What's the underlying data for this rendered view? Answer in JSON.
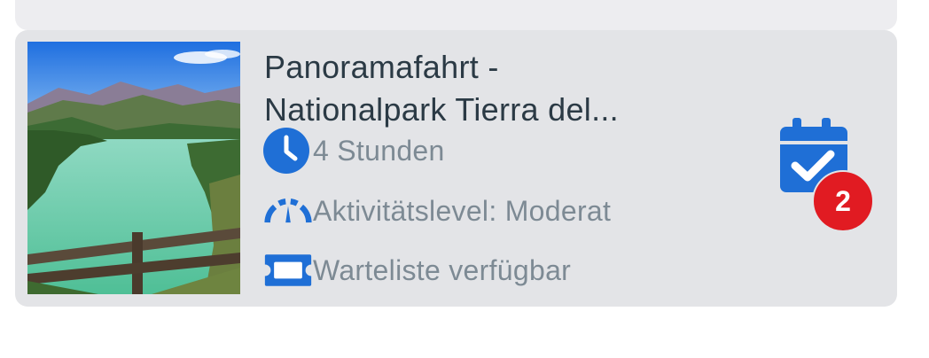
{
  "card": {
    "title_line1": "Panoramafahrt -",
    "title_line2": "Nationalpark Tierra del...",
    "duration": "4 Stunden",
    "activity_level": "Aktivitätslevel: Moderat",
    "availability": "Warteliste verfügbar",
    "booking_count": "2",
    "icons": {
      "duration": "clock-icon",
      "level": "speedometer-icon",
      "availability": "ticket-icon",
      "booking": "calendar-check-icon"
    },
    "colors": {
      "accent": "#1f6fd6",
      "badge": "#e11b22",
      "title_text": "#2b3a45",
      "meta_text": "#7d8a94",
      "card_bg": "#e3e4e7"
    }
  }
}
